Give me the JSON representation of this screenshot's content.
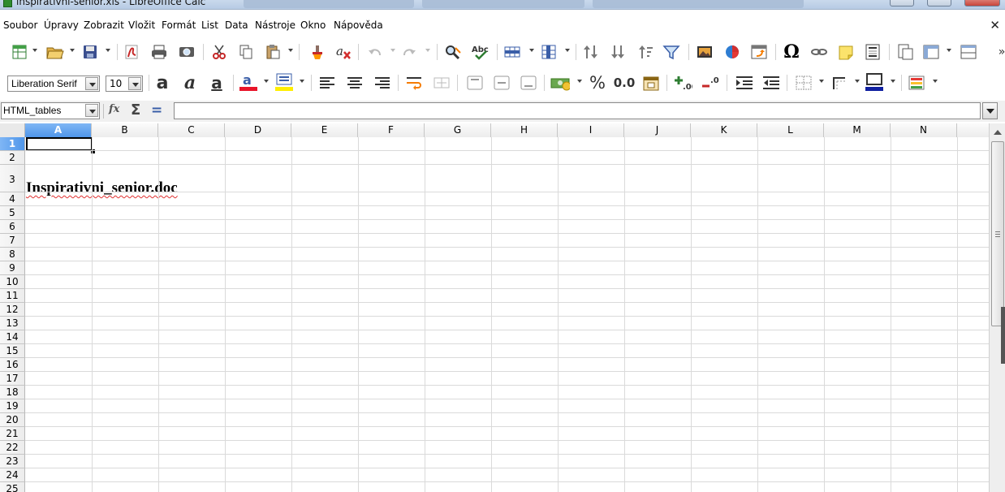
{
  "window": {
    "title": "inspirativni-senior.xls - LibreOffice Calc"
  },
  "menu": {
    "items": [
      "Soubor",
      "Úpravy",
      "Zobrazit",
      "Vložit",
      "Formát",
      "List",
      "Data",
      "Nástroje",
      "Okno",
      "Nápověda"
    ]
  },
  "toolbar": {
    "font_name": "Liberation Serif",
    "font_size": "10",
    "number_format_percent": "%",
    "number_format_decimal": "0.0",
    "bold_glyph": "a",
    "italic_glyph": "a",
    "underline_glyph": "a",
    "special_char_glyph": "Ω",
    "spell_label": "Abc",
    "overflow_glyph": "»",
    "colors": {
      "font_color": "#e8142a",
      "highlight_color": "#ffee00",
      "border_color": "#1020a0"
    }
  },
  "formula_bar": {
    "name_box": "HTML_tables",
    "fx_glyph": "fx",
    "sum_glyph": "Σ",
    "equals_glyph": "=",
    "content": ""
  },
  "sheet": {
    "columns": [
      "A",
      "B",
      "C",
      "D",
      "E",
      "F",
      "G",
      "H",
      "I",
      "J",
      "K",
      "L",
      "M",
      "N"
    ],
    "rows": [
      "1",
      "2",
      "3",
      "4",
      "5",
      "6",
      "7",
      "8",
      "9",
      "10",
      "11",
      "12",
      "13",
      "14",
      "15",
      "16",
      "17",
      "18",
      "19",
      "20",
      "21",
      "22",
      "23",
      "24",
      "25"
    ],
    "active_column": "A",
    "active_row": "1",
    "cell_a3": "Inspirativni_senior.doc"
  }
}
